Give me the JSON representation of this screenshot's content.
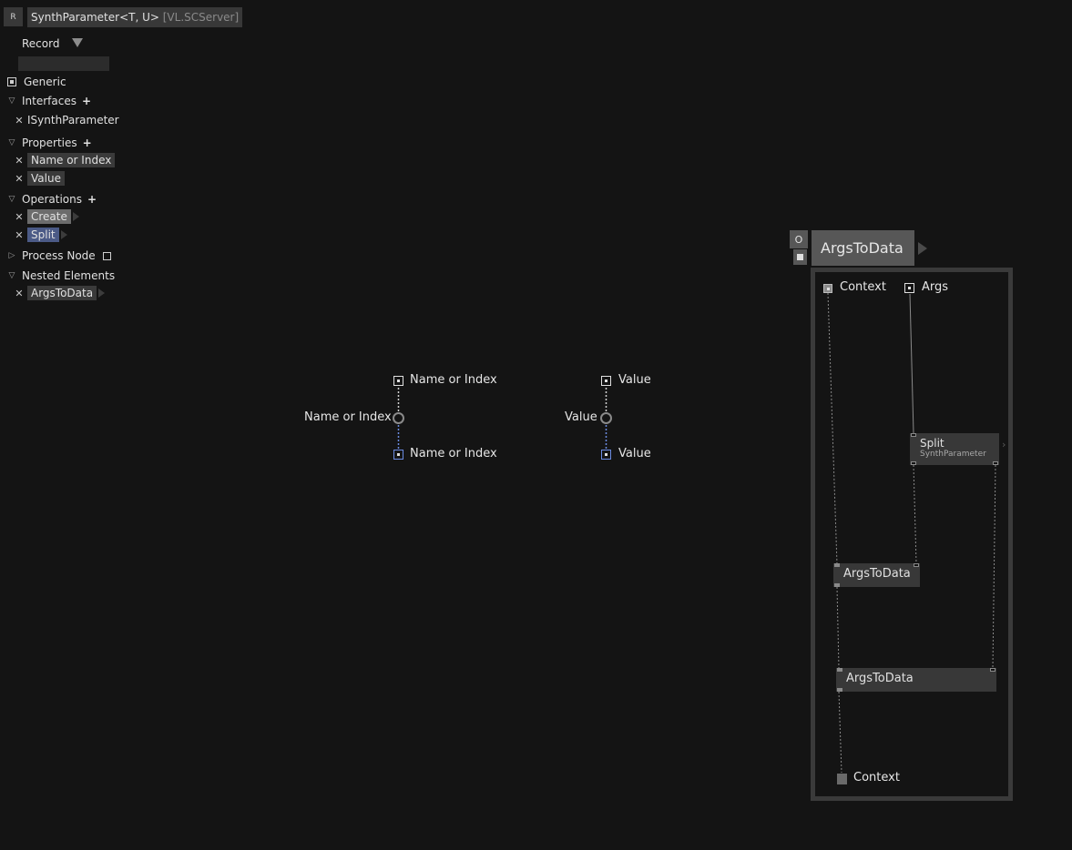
{
  "header": {
    "badge": "R",
    "type_name": "SynthParameter<T, U>",
    "namespace": "[VL.SCServer]"
  },
  "record": {
    "label": "Record"
  },
  "search": {
    "placeholder": ""
  },
  "sidebar": {
    "generic": "Generic",
    "interfaces": {
      "label": "Interfaces",
      "items": [
        "ISynthParameter"
      ]
    },
    "properties": {
      "label": "Properties",
      "items": [
        "Name or Index",
        "Value"
      ]
    },
    "operations": {
      "label": "Operations",
      "items": [
        "Create",
        "Split"
      ]
    },
    "process_node": "Process Node",
    "nested": {
      "label": "Nested Elements",
      "items": [
        "ArgsToData"
      ]
    }
  },
  "canvas": {
    "prop1": {
      "input": "Name or Index",
      "pad": "Name or Index",
      "output": "Name or Index"
    },
    "prop2": {
      "input": "Value",
      "pad": "Value",
      "output": "Value"
    }
  },
  "region": {
    "title": "ArgsToData",
    "o_button": "O",
    "inputs": [
      "Context",
      "Args"
    ],
    "split_node": {
      "name": "Split",
      "category": "SynthParameter"
    },
    "node1": "ArgsToData",
    "node2": "ArgsToData",
    "output": "Context"
  },
  "colors": {
    "background": "#141414",
    "selected": "#4b5a86",
    "highlight": "#6c6c6c",
    "link_blue": "#6a8ae0"
  }
}
